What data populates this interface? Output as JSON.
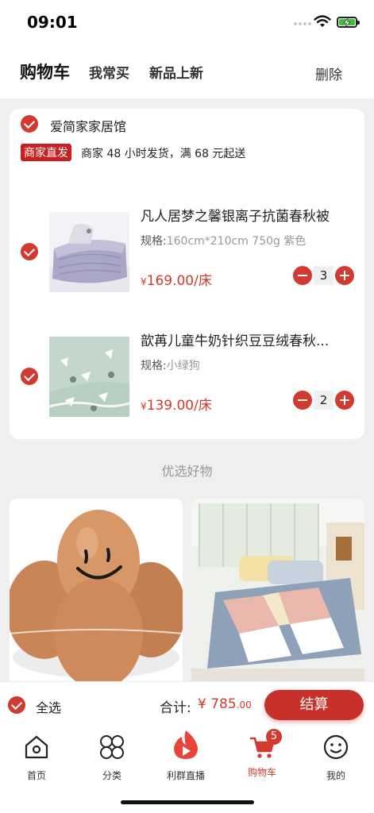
{
  "status_bar": {
    "time": "09:01"
  },
  "header": {
    "tabs": [
      {
        "label": "购物车"
      },
      {
        "label": "我常买"
      },
      {
        "label": "新品上新"
      }
    ],
    "delete_label": "删除"
  },
  "shop": {
    "name": "爱简家家居馆",
    "badge": "商家直发",
    "shipping_note": "商家 48 小时发货，满 68 元起送"
  },
  "cart_items": [
    {
      "title": "凡人居梦之馨银离子抗菌春秋被",
      "spec_label": "规格:",
      "spec_value": "160cm*210cm 750g 紫色",
      "currency": "¥",
      "price": "169.00/床",
      "quantity": "3",
      "checked": true
    },
    {
      "title": "歆苒儿童牛奶针织豆豆绒春秋...",
      "spec_label": "规格:",
      "spec_value": "小绿狗",
      "currency": "¥",
      "price": "139.00/床",
      "quantity": "2",
      "checked": true
    }
  ],
  "recommend": {
    "title": "优选好物"
  },
  "checkout": {
    "select_all": "全选",
    "total_label": "合计:",
    "total_currency": "¥",
    "total_main": "785",
    "total_decimal": ".00",
    "pay_label": "结算"
  },
  "tabbar": {
    "items": [
      {
        "label": "首页",
        "icon": "home-icon"
      },
      {
        "label": "分类",
        "icon": "category-icon"
      },
      {
        "label": "利群直播",
        "icon": "live-fire-icon"
      },
      {
        "label": "购物车",
        "icon": "cart-icon",
        "badge": "5"
      },
      {
        "label": "我的",
        "icon": "profile-icon"
      }
    ]
  },
  "colors": {
    "accent": "#d23a2f",
    "badge_bg": "#c8201e",
    "background": "#efefef"
  }
}
